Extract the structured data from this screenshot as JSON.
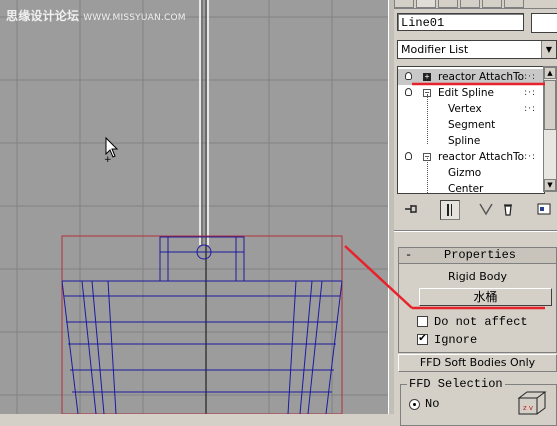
{
  "viewport": {
    "watermark_text": "思缘设计论坛",
    "watermark_url": "WWW.MISSYUAN.COM"
  },
  "panel": {
    "object_name": "Line01",
    "modifier_list": "Modifier List",
    "stack": [
      {
        "label": "reactor AttachTo",
        "selected": true
      },
      {
        "label": "Edit Spline"
      },
      {
        "label": "Vertex"
      },
      {
        "label": "Segment"
      },
      {
        "label": "Spline"
      },
      {
        "label": "reactor AttachTo"
      },
      {
        "label": "Gizmo"
      },
      {
        "label": "Center"
      }
    ],
    "toolbar": {
      "pin_icon": "pin-stack-icon",
      "show_end_icon": "show-end-result-icon",
      "make_unique_icon": "make-unique-icon",
      "remove_icon": "remove-modifier-icon",
      "configure_icon": "configure-sets-icon"
    }
  },
  "properties": {
    "toggle": "-",
    "title": "Properties",
    "rigid_label": "Rigid Body",
    "rigid_value": "水桶",
    "do_not_affect": "Do not affect",
    "do_not_affect_checked": false,
    "ignore": "Ignore",
    "ignore_checked": true,
    "check_mark": "✔",
    "ffd_button": "FFD Soft Bodies Only",
    "ffd_selection": "FFD Selection",
    "radio_no": "No"
  },
  "colors": {
    "annotation_red": "#e8222a",
    "wire_blue": "#1a1aa0",
    "bbox_red": "#b0303a",
    "grid": "#7e7e7e",
    "viewport_bg": "#9c9c9c"
  }
}
